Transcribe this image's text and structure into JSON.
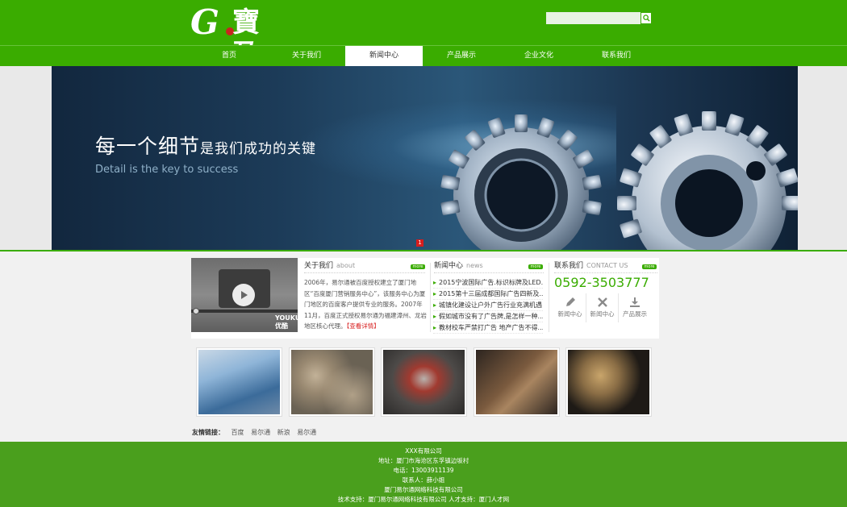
{
  "header": {
    "logo_mark": "G",
    "logo_text": "寶盈",
    "search": {
      "placeholder": "",
      "value": ""
    }
  },
  "nav": {
    "items": [
      {
        "label": "首页"
      },
      {
        "label": "关于我们"
      },
      {
        "label": "新闻中心",
        "active": true
      },
      {
        "label": "产品展示"
      },
      {
        "label": "企业文化"
      },
      {
        "label": "联系我们"
      }
    ]
  },
  "banner": {
    "title_large": "每一个细节",
    "title_small": "是我们成功的关键",
    "subtitle": "Detail is the key to success",
    "slide_index": "1"
  },
  "about": {
    "title": "关于我们",
    "title_en": "about",
    "more": "more",
    "text": "2006年，易尔通被百度授权建立了厦门地区“百度厦门营销服务中心”，该服务中心为厦门地区的百度客户提供专业的服务。2007年11月，百度正式授权易尔通为福建漳州、龙岩地区核心代理。",
    "detail_link": "【查看详情】",
    "video_brand": "YOUKU 优酷"
  },
  "news": {
    "title": "新闻中心",
    "title_en": "news",
    "more": "more",
    "items": [
      "2015宁波国际广告.标识标牌及LED...",
      "2015第十三届成都国际广告四新及...",
      "城镇化建设让户外广告行业充满机遇",
      "假如城市没有了广告牌,是怎样一种...",
      "教材校车严禁打广告 地产广告不得..."
    ]
  },
  "contact": {
    "title": "联系我们",
    "title_en": "CONTACT US",
    "more": "more",
    "phone": "0592-3503777",
    "quick_links": [
      {
        "label": "新闻中心",
        "icon": "pencil-icon"
      },
      {
        "label": "新闻中心",
        "icon": "tools-icon"
      },
      {
        "label": "产品展示",
        "icon": "download-icon"
      }
    ]
  },
  "gallery": {
    "items": [
      {
        "alt": "factory line",
        "colors": [
          "#3b6b9a",
          "#8fb5d8",
          "#c9d8e6"
        ]
      },
      {
        "alt": "gears",
        "colors": [
          "#2a2620",
          "#6b5a44",
          "#a89478"
        ]
      },
      {
        "alt": "belt machine",
        "colors": [
          "#4d4a48",
          "#a13a30",
          "#b8b2ad"
        ]
      },
      {
        "alt": "metal parts",
        "colors": [
          "#2d2520",
          "#7a5a3e",
          "#a98560"
        ]
      },
      {
        "alt": "brass gears",
        "colors": [
          "#1e1a16",
          "#8a6d45",
          "#c9a56b"
        ]
      }
    ]
  },
  "links": {
    "label": "友情链接：",
    "items": [
      "百度",
      "易尔通",
      "新浪",
      "易尔通"
    ]
  },
  "footer": {
    "lines": [
      "XXX有限公司",
      "地址：厦门市海沧区东孚镇边坂村",
      "电话：13003911139",
      "联系人：薛小姐",
      "厦门易尔通网络科技有限公司",
      "技术支持：厦门易尔通网络科技有限公司  人才支持：厦门人才网"
    ]
  },
  "colors": {
    "brand_green": "#3aac00",
    "footer_green": "#4a9f1d",
    "accent_red": "#d71d1d"
  }
}
